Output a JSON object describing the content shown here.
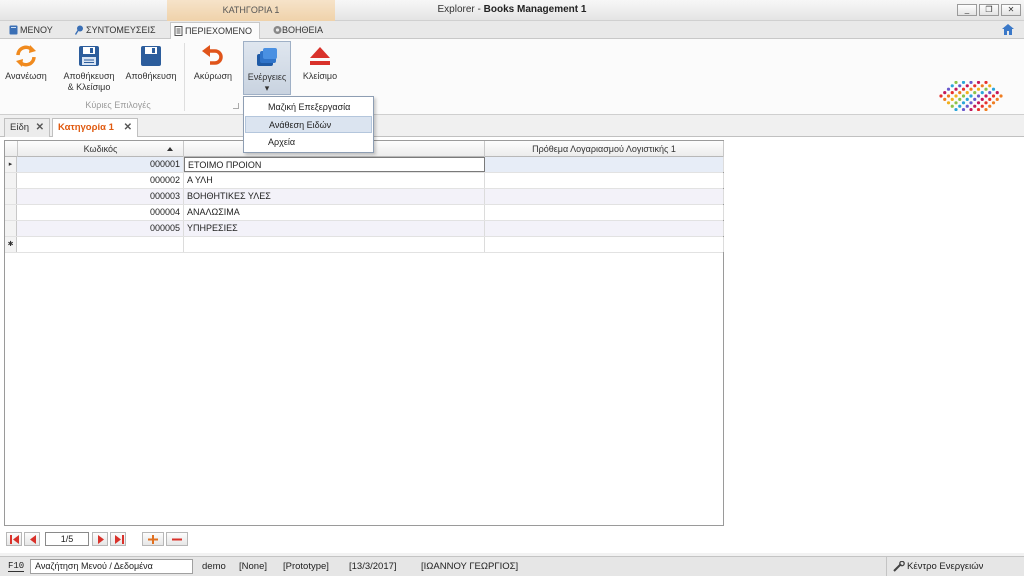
{
  "window": {
    "context_tab_header": "ΚΑΤΗΓΟΡΙΑ 1",
    "title_prefix": "Explorer",
    "title_sep": " - ",
    "title_main": "Books Management 1",
    "minimize": "_",
    "restore": "❐",
    "close": "✕"
  },
  "ribbon_tabs": [
    {
      "label": "ΜΕΝΟΥ",
      "icon": "book-icon"
    },
    {
      "label": "ΣΥΝΤΟΜΕΥΣΕΙΣ",
      "icon": "pin-icon"
    },
    {
      "label": "ΠΕΡΙΕΧΟΜΕΝΟ",
      "icon": "document-icon",
      "active": true
    },
    {
      "label": "ΒΟΗΘΕΙΑ",
      "icon": "help-icon"
    }
  ],
  "ribbon": {
    "buttons": [
      {
        "line1": "Ανανέωση",
        "line2": "",
        "icon": "refresh-icon"
      },
      {
        "line1": "Αποθήκευση",
        "line2": "& Κλείσιμο",
        "icon": "save-close-icon"
      },
      {
        "line1": "Αποθήκευση",
        "line2": "",
        "icon": "save-icon"
      },
      {
        "line1": "Ακύρωση",
        "line2": "",
        "icon": "undo-icon"
      },
      {
        "line1": "Ενέργειες",
        "line2": "▾",
        "icon": "actions-icon"
      },
      {
        "line1": "Κλείσιμο",
        "line2": "",
        "icon": "eject-icon"
      }
    ],
    "group_label": "Κύριες Επιλογές"
  },
  "actions_menu": {
    "items": [
      {
        "label": "Μαζική Επεξεργασία"
      },
      {
        "label": "Ανάθεση Ειδών",
        "highlighted": true
      },
      {
        "label": "Αρχεία"
      }
    ]
  },
  "doc_tabs": [
    {
      "label": "Είδη",
      "close": "✕"
    },
    {
      "label": "Κατηγορία 1",
      "close": "✕",
      "active": true
    }
  ],
  "grid": {
    "columns": [
      "Κωδικός",
      "",
      "Πρόθεμα Λογαριασμού Λογιστικής 1"
    ],
    "rows": [
      {
        "code": "000001",
        "description": "ΕΤΟΙΜΟ ΠΡΟΙΟΝ",
        "prefix": ""
      },
      {
        "code": "000002",
        "description": "Α ΥΛΗ",
        "prefix": ""
      },
      {
        "code": "000003",
        "description": "ΒΟΗΘΗΤΙΚΕΣ ΥΛΕΣ",
        "prefix": ""
      },
      {
        "code": "000004",
        "description": "ΑΝΑΛΩΣΙΜΑ",
        "prefix": ""
      },
      {
        "code": "000005",
        "description": "ΥΠΗΡΕΣΙΕΣ",
        "prefix": ""
      }
    ],
    "current_row_marker": "▸",
    "new_row_marker": "✱"
  },
  "navigator": {
    "page": "1/5",
    "first": "first-icon",
    "prev": "prev-icon",
    "next": "next-icon",
    "last": "last-icon",
    "add": "plus-icon",
    "remove": "minus-icon"
  },
  "status": {
    "key": "F10",
    "search_placeholder": "Αναζήτηση Μενού / Δεδομένα",
    "user": "demo",
    "none": "[None]",
    "mode": "[Prototype]",
    "date": "[13/3/2017]",
    "person": "[ΙΩΑΝΝΟΥ ΓΕΩΡΓΙΟΣ]",
    "action_center": "Κέντρο Ενεργειών"
  },
  "colors": {
    "accent_orange": "#e05a10",
    "context_tab": "#efd2aa",
    "menu_hover": "#dbe4f0"
  }
}
